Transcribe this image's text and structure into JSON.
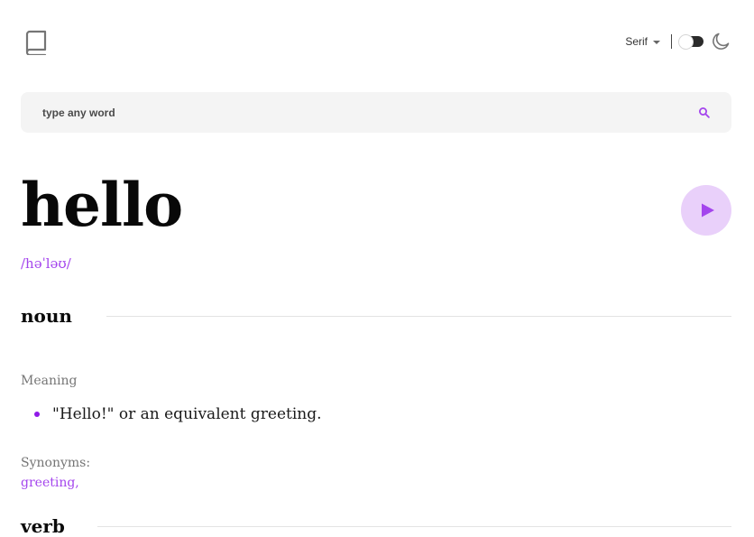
{
  "header": {
    "font_select_label": "Serif",
    "theme_toggle_state": "off",
    "icons": [
      "book-icon",
      "chevron-down-icon",
      "moon-icon"
    ]
  },
  "search": {
    "placeholder": "type any word",
    "value": "",
    "icon": "search-icon"
  },
  "entry": {
    "word": "hello",
    "phonetic": "/həˈləʊ/",
    "play_icon": "play-icon",
    "meanings": [
      {
        "part_of_speech": "noun",
        "meaning_label": "Meaning",
        "definitions": [
          "\"Hello!\" or an equivalent greeting."
        ],
        "synonyms_label": "Synonyms:",
        "synonyms": [
          "greeting,"
        ]
      },
      {
        "part_of_speech": "verb"
      }
    ]
  },
  "colors": {
    "accent": "#a445ed",
    "play_bg": "#e9d0fa",
    "search_bg": "#f4f4f4",
    "divider": "#e3e3e3",
    "muted_text": "#757575"
  }
}
